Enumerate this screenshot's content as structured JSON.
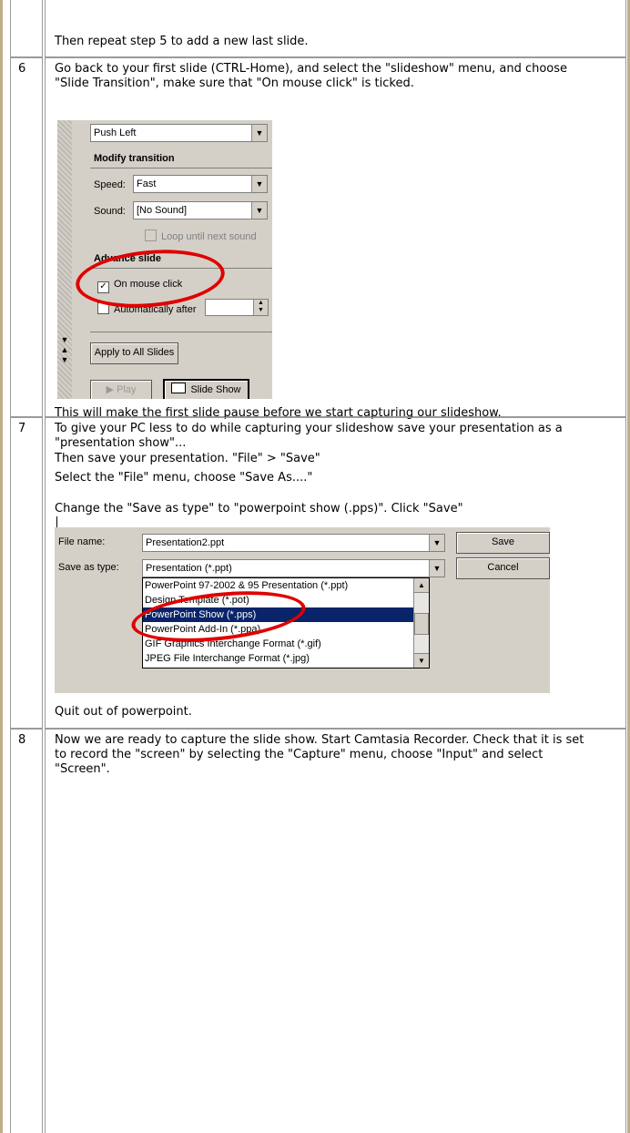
{
  "steps": {
    "step5_tail": {
      "text": "Then repeat step 5 to add a new last slide."
    },
    "step6": {
      "number": "6",
      "intro": "Go back to your first slide (CTRL-Home), and select the \"slideshow\" menu, and choose \"Slide Transition\", make sure that \"On mouse click\" is ticked.",
      "after_text": "This will make the first slide pause before we start capturing our slideshow.",
      "save_text": "Then save your presentation. \"File\" > \"Save\""
    },
    "step7": {
      "number": "7",
      "intro": "To give your PC less to do while capturing your slideshow save your presentation as a \"presentation show\"...",
      "select_text": "Select the \"File\" menu, choose \"Save As....\"",
      "change_text": "Change the \"Save as type\" to \"powerpoint show (.pps)\". Click \"Save\"",
      "quit_text": "Quit out of powerpoint."
    },
    "step8": {
      "number": "8",
      "intro": "Now we are ready to capture the slide show. Start Camtasia Recorder. Check that it is set to record the \"screen\" by selecting the \"Capture\" menu, choose \"Input\" and select \"Screen\"."
    }
  },
  "transition_panel": {
    "effect_value": "Push Left",
    "modify_heading": "Modify transition",
    "speed_label": "Speed:",
    "speed_value": "Fast",
    "sound_label": "Sound:",
    "sound_value": "[No Sound]",
    "loop_label": "Loop until next sound",
    "advance_heading": "Advance slide",
    "on_mouse_click_label": "On mouse click",
    "on_mouse_click_checked": true,
    "auto_after_label": "Automatically after",
    "apply_all_label": "Apply to All Slides",
    "play_label": "Play",
    "slideshow_label": "Slide Show"
  },
  "save_dialog": {
    "file_name_label": "File name:",
    "file_name_value": "Presentation2.ppt",
    "save_type_label": "Save as type:",
    "save_type_value": "Presentation (*.ppt)",
    "save_button": "Save",
    "cancel_button": "Cancel",
    "type_options": [
      "PowerPoint 97-2002 & 95 Presentation (*.ppt)",
      "Design Template (*.pot)",
      "PowerPoint Show (*.pps)",
      "PowerPoint Add-In (*.ppa)",
      "GIF Graphics Interchange Format (*.gif)",
      "JPEG File Interchange Format (*.jpg)"
    ],
    "selected_option_index": 2
  },
  "colors": {
    "annotation_ring": "#e00000",
    "selection": "#0a246a",
    "border_accent": "#bfae8c"
  }
}
